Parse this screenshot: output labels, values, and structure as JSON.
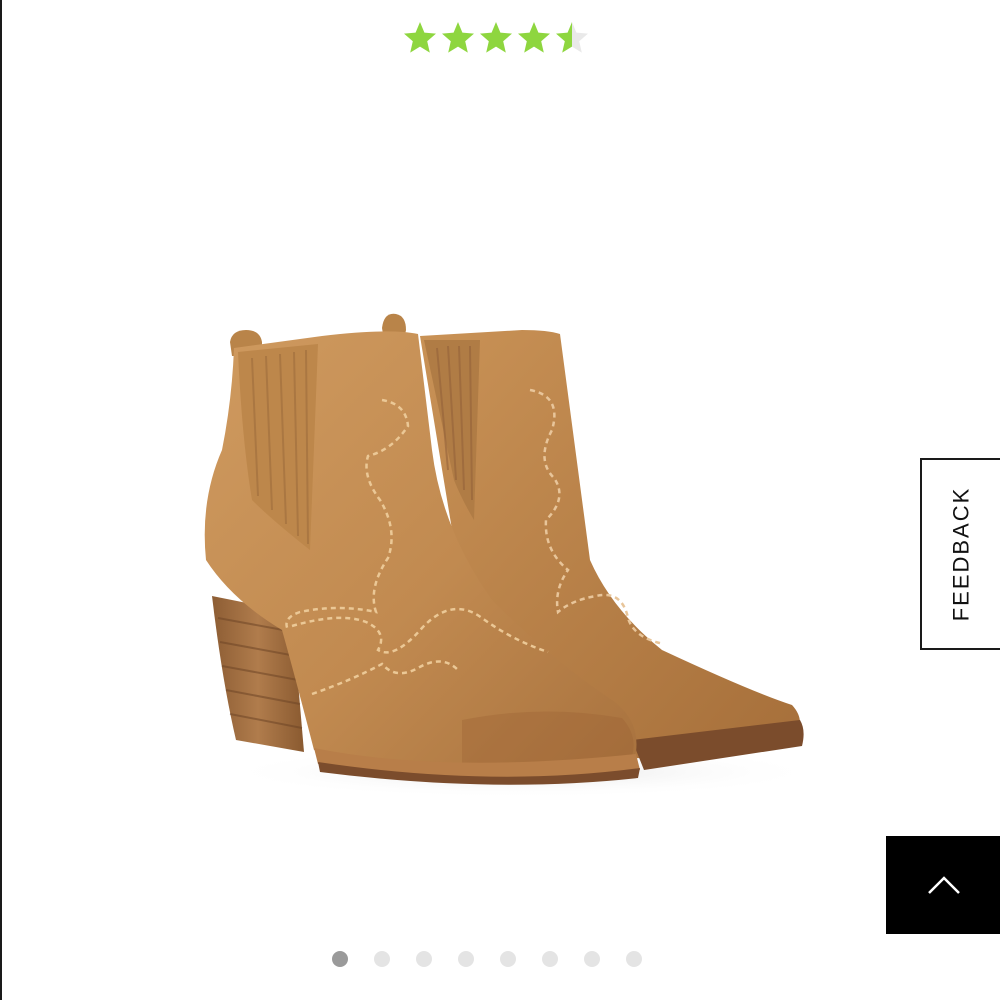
{
  "rating": {
    "value": 4.5,
    "max": 5,
    "filled_color": "#8ed63f",
    "empty_color": "#e9e9e9"
  },
  "product_image": {
    "description_icon": "ankle-boots-image",
    "main_color": "#c58e52",
    "heel_color": "#a06a3d"
  },
  "feedback": {
    "label": "FEEDBACK"
  },
  "scroll_top": {
    "icon": "chevron-up-icon"
  },
  "carousel": {
    "total": 8,
    "active_index": 0
  }
}
